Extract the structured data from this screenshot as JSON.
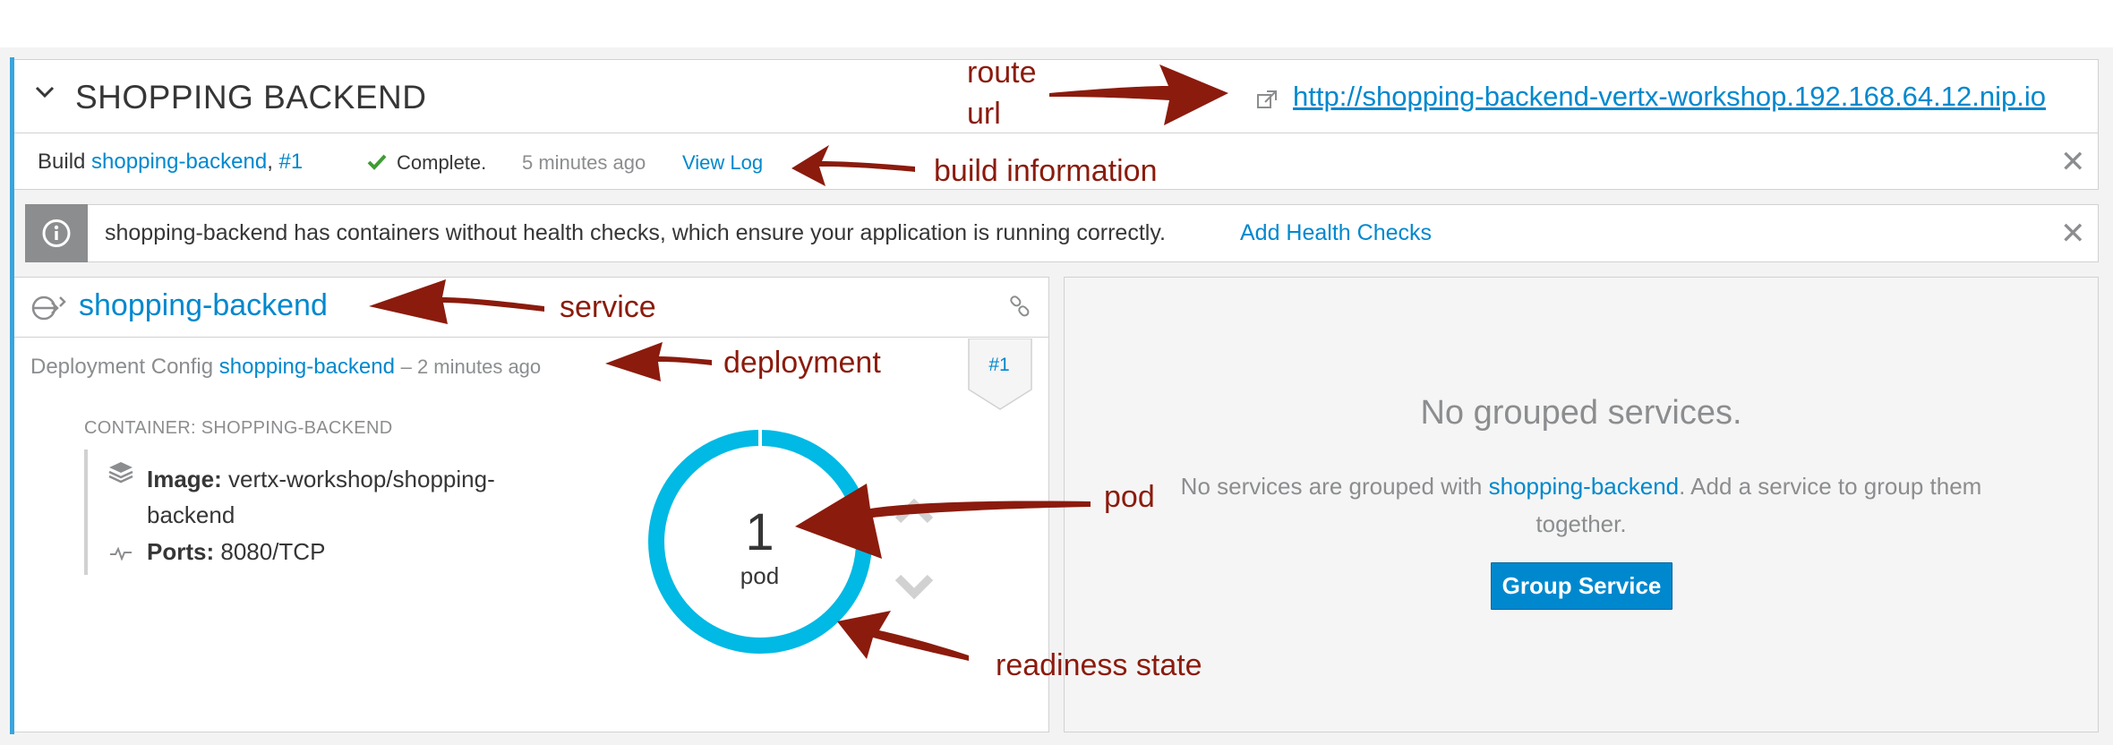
{
  "app": {
    "title": "SHOPPING BACKEND",
    "route_url": "http://shopping-backend-vertx-workshop.192.168.64.12.nip.io"
  },
  "build": {
    "prefix": "Build",
    "name": "shopping-backend",
    "sep": ",",
    "number": "#1",
    "status": "Complete.",
    "time": "5 minutes ago",
    "view_log": "View Log"
  },
  "alert": {
    "message": "shopping-backend has containers without health checks, which ensure your application is running correctly.",
    "action": "Add Health Checks"
  },
  "service": {
    "name": "shopping-backend",
    "deployment_prefix": "Deployment Config",
    "deployment_name": "shopping-backend",
    "deployment_time": "– 2 minutes ago",
    "deployment_badge": "#1",
    "container_label": "CONTAINER: SHOPPING-BACKEND",
    "image_key": "Image:",
    "image_value": "vertx-workshop/shopping-backend",
    "ports_key": "Ports:",
    "ports_value": "8080/TCP",
    "pod_count": "1",
    "pod_word": "pod"
  },
  "grouped": {
    "title": "No grouped services.",
    "desc_prefix": "No services are grouped with",
    "desc_link": "shopping-backend",
    "desc_suffix": ". Add a service to group them together.",
    "button": "Group Service"
  },
  "annotations": {
    "route_url": "route url",
    "route_line1": "route",
    "route_line2": "url",
    "build": "build information",
    "service": "service",
    "deployment": "deployment",
    "pod": "pod",
    "readiness": "readiness state"
  },
  "colors": {
    "accent": "#39a5dc",
    "link": "#0088ce",
    "pod_ring": "#00b9e4",
    "annotation": "#8b1b0d",
    "button": "#0088ce"
  }
}
